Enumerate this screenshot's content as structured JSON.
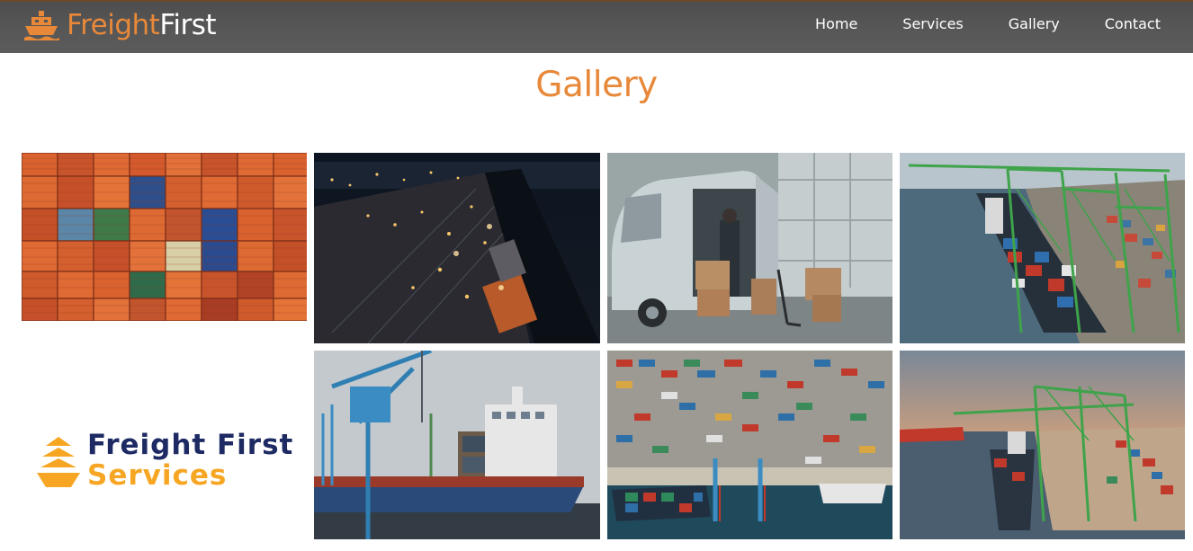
{
  "navbar": {
    "brand_part1": "Freight",
    "brand_part2": "First",
    "brand_icon": "ship-icon",
    "links": [
      "Home",
      "Services",
      "Gallery",
      "Contact"
    ]
  },
  "page": {
    "title": "Gallery"
  },
  "gallery": {
    "images": [
      {
        "name": "stacked-shipping-containers"
      },
      {
        "name": "port-at-night-aerial"
      },
      {
        "name": "delivery-van-loading-boxes"
      },
      {
        "name": "container-ship-with-cranes"
      },
      {
        "name": "cargo-ship-with-harbor-crane"
      },
      {
        "name": "container-terminal-aerial"
      },
      {
        "name": "container-port-at-sunset"
      }
    ],
    "logo": {
      "line1": "Freight First",
      "line2": "Services",
      "icon": "ship-logo-icon"
    }
  },
  "colors": {
    "accent": "#e8893a",
    "nav_bg": "#575757",
    "logo_navy": "#1e2a63",
    "logo_orange": "#f6a623"
  }
}
